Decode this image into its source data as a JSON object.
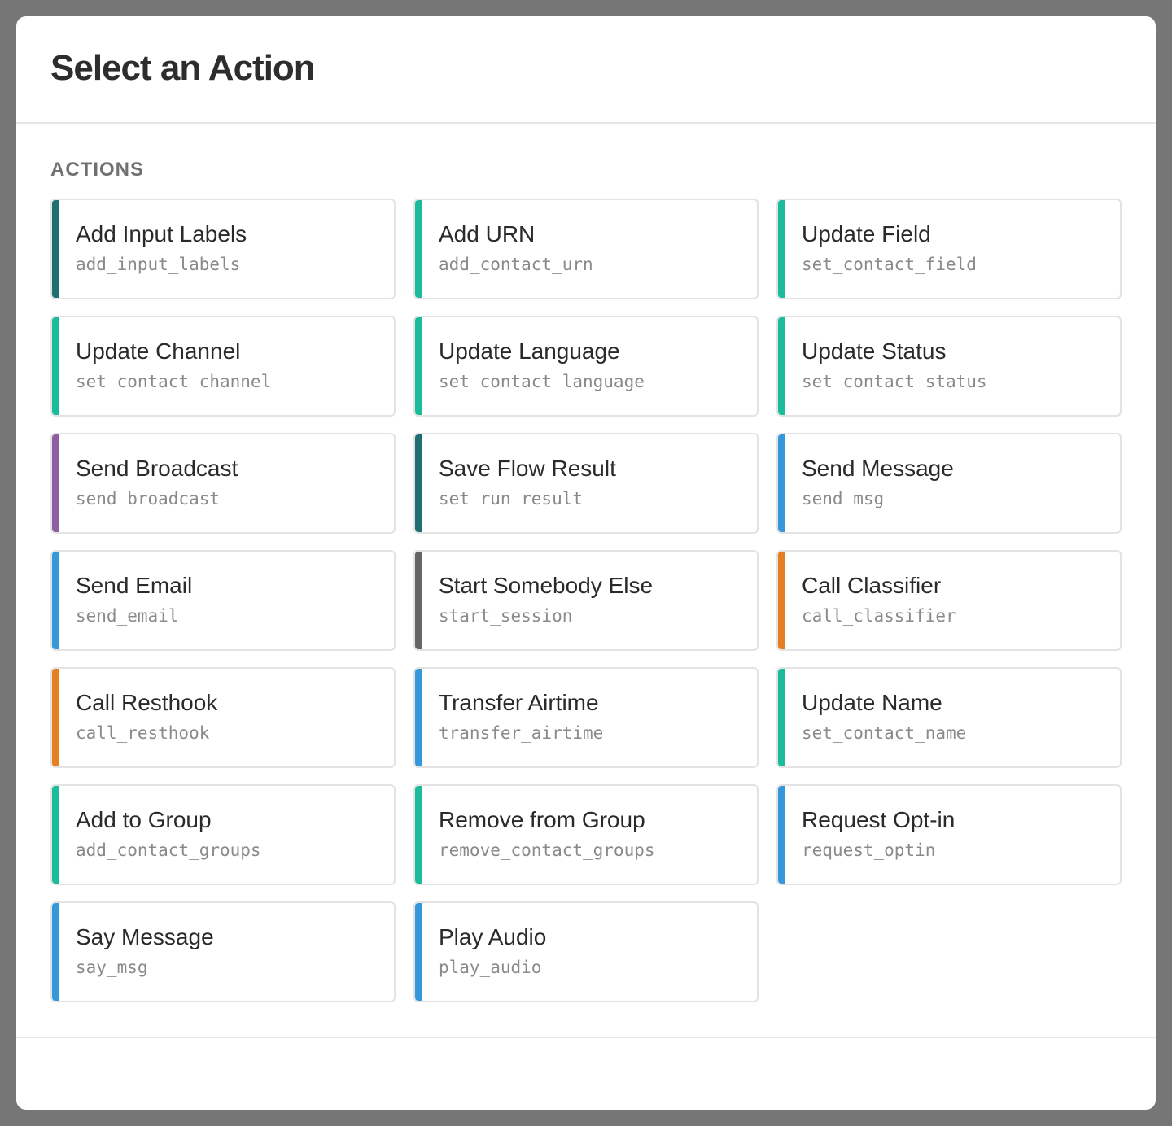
{
  "dialog": {
    "title": "Select an Action",
    "section_title": "ACTIONS"
  },
  "actions": [
    {
      "name": "Add Input Labels",
      "code": "add_input_labels",
      "color": "#1f6e72"
    },
    {
      "name": "Add URN",
      "code": "add_contact_urn",
      "color": "#1abc9c"
    },
    {
      "name": "Update Field",
      "code": "set_contact_field",
      "color": "#1abc9c"
    },
    {
      "name": "Update Channel",
      "code": "set_contact_channel",
      "color": "#1abc9c"
    },
    {
      "name": "Update Language",
      "code": "set_contact_language",
      "color": "#1abc9c"
    },
    {
      "name": "Update Status",
      "code": "set_contact_status",
      "color": "#1abc9c"
    },
    {
      "name": "Send Broadcast",
      "code": "send_broadcast",
      "color": "#8e5ea2"
    },
    {
      "name": "Save Flow Result",
      "code": "set_run_result",
      "color": "#1f6e72"
    },
    {
      "name": "Send Message",
      "code": "send_msg",
      "color": "#3498db"
    },
    {
      "name": "Send Email",
      "code": "send_email",
      "color": "#3498db"
    },
    {
      "name": "Start Somebody Else",
      "code": "start_session",
      "color": "#666666"
    },
    {
      "name": "Call Classifier",
      "code": "call_classifier",
      "color": "#e67e22"
    },
    {
      "name": "Call Resthook",
      "code": "call_resthook",
      "color": "#e67e22"
    },
    {
      "name": "Transfer Airtime",
      "code": "transfer_airtime",
      "color": "#3498db"
    },
    {
      "name": "Update Name",
      "code": "set_contact_name",
      "color": "#1abc9c"
    },
    {
      "name": "Add to Group",
      "code": "add_contact_groups",
      "color": "#1abc9c"
    },
    {
      "name": "Remove from Group",
      "code": "remove_contact_groups",
      "color": "#1abc9c"
    },
    {
      "name": "Request Opt-in",
      "code": "request_optin",
      "color": "#3498db"
    },
    {
      "name": "Say Message",
      "code": "say_msg",
      "color": "#3498db"
    },
    {
      "name": "Play Audio",
      "code": "play_audio",
      "color": "#3498db"
    }
  ]
}
